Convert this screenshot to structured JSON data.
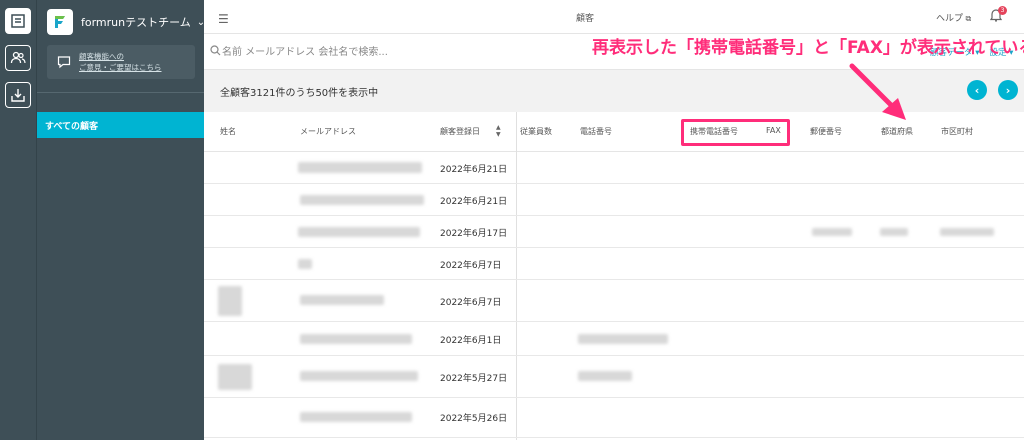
{
  "annotation": {
    "text": "再表示した「携帯電話番号」と「FAX」が表示されている"
  },
  "sidebar": {
    "team_name": "formrunテストチーム",
    "feedback_line1": "顧客機能への",
    "feedback_line2": "ご意見・ご要望はこちら",
    "active_item": "すべての顧客"
  },
  "topbar": {
    "title": "顧客",
    "help": "ヘルプ",
    "badge_count": "3"
  },
  "search": {
    "placeholder": "名前 メールアドレス 会社名で検索...",
    "link_data": "顧客データ ▾",
    "link_settings": "設定 ▾"
  },
  "count": {
    "text": "全顧客3121件のうち50件を表示中"
  },
  "columns": {
    "name": "姓名",
    "email": "メールアドレス",
    "registered": "顧客登録日",
    "employees": "従業員数",
    "phone": "電話番号",
    "mobile": "携帯電話番号",
    "fax": "FAX",
    "zip": "郵便番号",
    "prefecture": "都道府県",
    "city": "市区町村"
  },
  "rows": [
    {
      "date": "2022年6月21日"
    },
    {
      "date": "2022年6月21日"
    },
    {
      "date": "2022年6月17日"
    },
    {
      "date": "2022年6月7日"
    },
    {
      "date": "2022年6月7日"
    },
    {
      "date": "2022年6月1日"
    },
    {
      "date": "2022年5月27日"
    },
    {
      "date": "2022年5月26日"
    }
  ],
  "colors": {
    "accent": "#00b4d2",
    "sidebar": "#3e4f57",
    "annotation": "#ff2d7a"
  }
}
